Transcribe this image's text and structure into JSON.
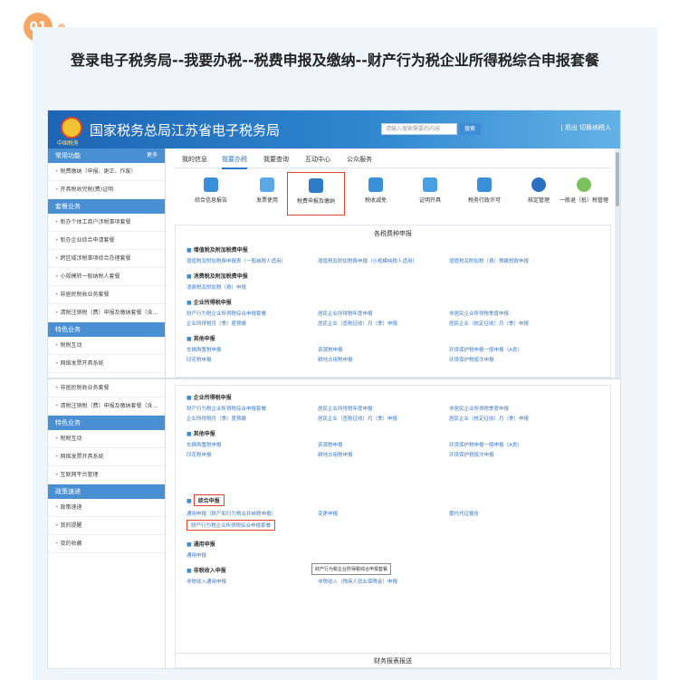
{
  "badge": "01",
  "heading": "登录电子税务局--我要办税--税费申报及缴纳--财产行为税企业所得税综合申报套餐",
  "site": {
    "title": "国家税务总局江苏省电子税务局",
    "emblem_sub": "中国税务",
    "search_placeholder": "请输入搜索需要的内容",
    "search_btn": "搜索",
    "exit": "| 退出 切换纳税人"
  },
  "side1": {
    "head": "常用功能",
    "more": "更多",
    "items": [
      "税费缴纳（申报、更正、作废）",
      "开具税收完税(费)证明"
    ],
    "head2": "套餐业务",
    "items2": [
      "新办个体工商户涉税事项套餐",
      "新办企业综合申请套餐",
      "跨区域涉税事项综合办理套餐",
      "小规模转一般纳税人套餐",
      "非居民税收业务套餐",
      "清税注销税（费）申报及缴纳套餐（含..."
    ],
    "head3": "特色业务",
    "items3": [
      "税税互动",
      "网络发票开具系统"
    ]
  },
  "tabs": [
    "我的信息",
    "我要办税",
    "我要查询",
    "互动中心",
    "公众服务"
  ],
  "icons": [
    "综合信息报告",
    "发票使用",
    "税费申报及缴纳",
    "税收减免",
    "证明开具",
    "税务行政许可",
    "核定管理",
    "一般退（抵）税管理"
  ],
  "panel": {
    "title": "各税费种申报",
    "sec1": "增值税及附加税费申报",
    "r1": [
      "增值税及附加税费申报表（一般纳税人适用）",
      "增值税及附加税费申报（小规模纳税人适用）",
      "增值税及附加税（费）预缴税款申报"
    ],
    "sec2": "消费税及附加税费申报",
    "r2": [
      "消费税及附加税（费）申报"
    ],
    "sec3": "企业所得税申报",
    "r3": [
      "财产行为税企业所得税综合申报套餐",
      "居民企业所得税年度申报",
      "非居民企业所得税季度申报",
      "非居民企业所得税申报表"
    ],
    "r3b": [
      "企业所得税月（季）度预缴",
      "居民企业（查账征收）月（季）申报",
      "居民企业（核定征收）月（季）申报"
    ],
    "sec4": "其他申报",
    "r4": [
      "车辆购置税申报",
      "印花税申报",
      "资源税申报",
      "耕地占用税申报",
      "环境保护税申报一般申报（A类）",
      "环境保护税按次申报"
    ]
  },
  "side2": {
    "items": [
      "非居民税收业务套餐",
      "清税注销税（费）申报及缴纳套餐（含..."
    ],
    "head": "特色业务",
    "items2": [
      "税税互动",
      "网络发票开具系统",
      "互联网平台管理"
    ],
    "head2": "政策速递",
    "items3": [
      "政策速递",
      "我的提醒",
      "我的收藏"
    ]
  },
  "panel2": {
    "sec1": "企业所得税申报",
    "sec2": "其他申报",
    "sec3": "综合申报",
    "sec4": "通用申报",
    "sec5": "非税收入申报",
    "comp1": "通用申报（财产和行为税合并纳税申报）",
    "comp2": "财产行为税企业所得税综合申报套餐",
    "comp3": "变更申报",
    "comp4": "委托代征报告",
    "tooltip": "财产行为税企业所得税综合申报套餐",
    "gen": "通用申报",
    "n1": "非税收入通用申报",
    "n2": "非税收入（残疾人就业保障金）申报",
    "fin": "财务报表报送"
  }
}
